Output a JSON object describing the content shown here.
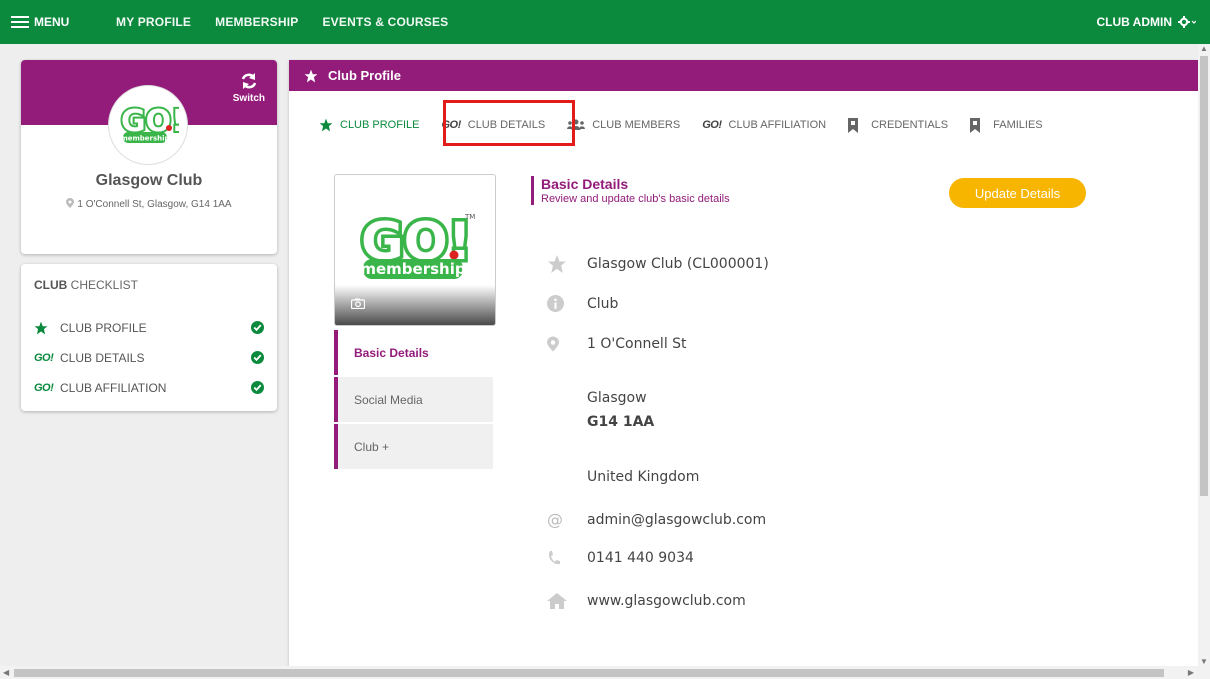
{
  "topnav": {
    "menu_label": "MENU",
    "links": [
      "MY PROFILE",
      "MEMBERSHIP",
      "EVENTS & COURSES"
    ],
    "user_menu": "CLUB ADMIN"
  },
  "profile": {
    "logo_text": "GO!",
    "logo_sub": "membership",
    "switch_label": "Switch",
    "club_name": "Glasgow Club",
    "address": "1 O'Connell St, Glasgow, G14 1AA"
  },
  "checklist": {
    "title_bold": "CLUB",
    "title_rest": " CHECKLIST",
    "items": [
      {
        "icon": "star-icon",
        "label": "CLUB PROFILE",
        "status": "complete"
      },
      {
        "icon": "go-icon",
        "label": "CLUB DETAILS",
        "status": "complete"
      },
      {
        "icon": "go-icon",
        "label": "CLUB AFFILIATION",
        "status": "complete"
      }
    ]
  },
  "main": {
    "header_title": "Club Profile",
    "tabs": [
      {
        "label": "CLUB PROFILE",
        "icon": "star-icon",
        "active": true
      },
      {
        "label": "CLUB DETAILS",
        "icon": "go-icon",
        "active": false
      },
      {
        "label": "CLUB MEMBERS",
        "icon": "people-icon",
        "active": false
      },
      {
        "label": "CLUB AFFILIATION",
        "icon": "go-icon",
        "active": false
      },
      {
        "label": "CREDENTIALS",
        "icon": "bookmark-icon",
        "active": false
      },
      {
        "label": "FAMILIES",
        "icon": "bookmark-icon",
        "active": false
      }
    ],
    "logo": {
      "text": "GO!",
      "sub": "membership",
      "tm": "TM"
    },
    "side_menu": [
      "Basic Details",
      "Social Media",
      "Club +"
    ],
    "section_title": "Basic Details",
    "section_subtitle": "Review and update club's basic details",
    "update_button": "Update Details",
    "details": {
      "name": "Glasgow Club (CL000001)",
      "type": "Club",
      "address_line1": "1 O'Connell St",
      "city": "Glasgow",
      "postcode": "G14 1AA",
      "country": "United Kingdom",
      "email": "admin@glasgowclub.com",
      "phone": "0141 440 9034",
      "website": "www.glasgowclub.com"
    }
  },
  "colors": {
    "nav_green": "#0b8a3e",
    "brand_purple": "#931b7a",
    "update_yellow": "#f7b500",
    "highlight_red": "#e21b1b"
  }
}
